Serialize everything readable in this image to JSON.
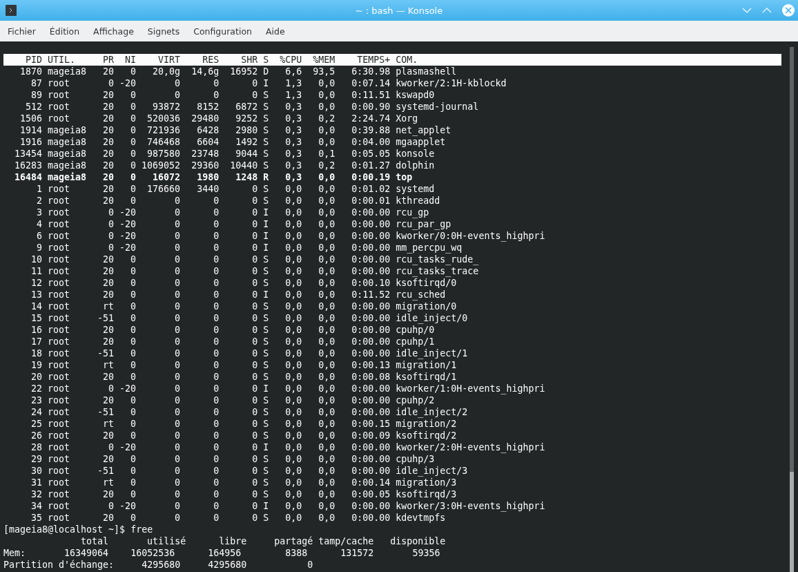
{
  "window": {
    "title": "~ : bash — Konsole"
  },
  "menu": [
    "Fichier",
    "Édition",
    "Affichage",
    "Signets",
    "Configuration",
    "Aide"
  ],
  "top": {
    "columns": [
      "PID",
      "UTIL.",
      "PR",
      "NI",
      "VIRT",
      "RES",
      "SHR",
      "S",
      "%CPU",
      "%MEM",
      "TEMPS+",
      "COM."
    ],
    "rows": [
      {
        "bold": false,
        "cells": [
          "1870",
          "mageia8",
          "20",
          "0",
          "20,0g",
          "14,6g",
          "16952",
          "D",
          "6,6",
          "93,5",
          "6:30.98",
          "plasmashell"
        ]
      },
      {
        "bold": false,
        "cells": [
          "87",
          "root",
          "0",
          "-20",
          "0",
          "0",
          "0",
          "I",
          "1,3",
          "0,0",
          "0:07.14",
          "kworker/2:1H-kblockd"
        ]
      },
      {
        "bold": false,
        "cells": [
          "89",
          "root",
          "20",
          "0",
          "0",
          "0",
          "0",
          "S",
          "1,3",
          "0,0",
          "0:11.51",
          "kswapd0"
        ]
      },
      {
        "bold": false,
        "cells": [
          "512",
          "root",
          "20",
          "0",
          "93872",
          "8152",
          "6872",
          "S",
          "0,3",
          "0,0",
          "0:00.90",
          "systemd-journal"
        ]
      },
      {
        "bold": false,
        "cells": [
          "1506",
          "root",
          "20",
          "0",
          "520036",
          "29480",
          "9252",
          "S",
          "0,3",
          "0,2",
          "2:24.74",
          "Xorg"
        ]
      },
      {
        "bold": false,
        "cells": [
          "1914",
          "mageia8",
          "20",
          "0",
          "721936",
          "6428",
          "2980",
          "S",
          "0,3",
          "0,0",
          "0:39.88",
          "net_applet"
        ]
      },
      {
        "bold": false,
        "cells": [
          "1916",
          "mageia8",
          "20",
          "0",
          "746468",
          "6604",
          "1492",
          "S",
          "0,3",
          "0,0",
          "0:04.00",
          "mgaapplet"
        ]
      },
      {
        "bold": false,
        "cells": [
          "13454",
          "mageia8",
          "20",
          "0",
          "987580",
          "23748",
          "9044",
          "S",
          "0,3",
          "0,1",
          "0:05.05",
          "konsole"
        ]
      },
      {
        "bold": false,
        "cells": [
          "16283",
          "mageia8",
          "20",
          "0",
          "1069052",
          "29360",
          "10440",
          "S",
          "0,3",
          "0,2",
          "0:01.27",
          "dolphin"
        ]
      },
      {
        "bold": true,
        "cells": [
          "16484",
          "mageia8",
          "20",
          "0",
          "16072",
          "1980",
          "1248",
          "R",
          "0,3",
          "0,0",
          "0:00.19",
          "top"
        ]
      },
      {
        "bold": false,
        "cells": [
          "1",
          "root",
          "20",
          "0",
          "176660",
          "3440",
          "0",
          "S",
          "0,0",
          "0,0",
          "0:01.02",
          "systemd"
        ]
      },
      {
        "bold": false,
        "cells": [
          "2",
          "root",
          "20",
          "0",
          "0",
          "0",
          "0",
          "S",
          "0,0",
          "0,0",
          "0:00.01",
          "kthreadd"
        ]
      },
      {
        "bold": false,
        "cells": [
          "3",
          "root",
          "0",
          "-20",
          "0",
          "0",
          "0",
          "I",
          "0,0",
          "0,0",
          "0:00.00",
          "rcu_gp"
        ]
      },
      {
        "bold": false,
        "cells": [
          "4",
          "root",
          "0",
          "-20",
          "0",
          "0",
          "0",
          "I",
          "0,0",
          "0,0",
          "0:00.00",
          "rcu_par_gp"
        ]
      },
      {
        "bold": false,
        "cells": [
          "6",
          "root",
          "0",
          "-20",
          "0",
          "0",
          "0",
          "I",
          "0,0",
          "0,0",
          "0:00.00",
          "kworker/0:0H-events_highpri"
        ]
      },
      {
        "bold": false,
        "cells": [
          "9",
          "root",
          "0",
          "-20",
          "0",
          "0",
          "0",
          "I",
          "0,0",
          "0,0",
          "0:00.00",
          "mm_percpu_wq"
        ]
      },
      {
        "bold": false,
        "cells": [
          "10",
          "root",
          "20",
          "0",
          "0",
          "0",
          "0",
          "S",
          "0,0",
          "0,0",
          "0:00.00",
          "rcu_tasks_rude_"
        ]
      },
      {
        "bold": false,
        "cells": [
          "11",
          "root",
          "20",
          "0",
          "0",
          "0",
          "0",
          "S",
          "0,0",
          "0,0",
          "0:00.00",
          "rcu_tasks_trace"
        ]
      },
      {
        "bold": false,
        "cells": [
          "12",
          "root",
          "20",
          "0",
          "0",
          "0",
          "0",
          "S",
          "0,0",
          "0,0",
          "0:00.10",
          "ksoftirqd/0"
        ]
      },
      {
        "bold": false,
        "cells": [
          "13",
          "root",
          "20",
          "0",
          "0",
          "0",
          "0",
          "I",
          "0,0",
          "0,0",
          "0:11.52",
          "rcu_sched"
        ]
      },
      {
        "bold": false,
        "cells": [
          "14",
          "root",
          "rt",
          "0",
          "0",
          "0",
          "0",
          "S",
          "0,0",
          "0,0",
          "0:00.00",
          "migration/0"
        ]
      },
      {
        "bold": false,
        "cells": [
          "15",
          "root",
          "-51",
          "0",
          "0",
          "0",
          "0",
          "S",
          "0,0",
          "0,0",
          "0:00.00",
          "idle_inject/0"
        ]
      },
      {
        "bold": false,
        "cells": [
          "16",
          "root",
          "20",
          "0",
          "0",
          "0",
          "0",
          "S",
          "0,0",
          "0,0",
          "0:00.00",
          "cpuhp/0"
        ]
      },
      {
        "bold": false,
        "cells": [
          "17",
          "root",
          "20",
          "0",
          "0",
          "0",
          "0",
          "S",
          "0,0",
          "0,0",
          "0:00.00",
          "cpuhp/1"
        ]
      },
      {
        "bold": false,
        "cells": [
          "18",
          "root",
          "-51",
          "0",
          "0",
          "0",
          "0",
          "S",
          "0,0",
          "0,0",
          "0:00.00",
          "idle_inject/1"
        ]
      },
      {
        "bold": false,
        "cells": [
          "19",
          "root",
          "rt",
          "0",
          "0",
          "0",
          "0",
          "S",
          "0,0",
          "0,0",
          "0:00.13",
          "migration/1"
        ]
      },
      {
        "bold": false,
        "cells": [
          "20",
          "root",
          "20",
          "0",
          "0",
          "0",
          "0",
          "S",
          "0,0",
          "0,0",
          "0:00.08",
          "ksoftirqd/1"
        ]
      },
      {
        "bold": false,
        "cells": [
          "22",
          "root",
          "0",
          "-20",
          "0",
          "0",
          "0",
          "I",
          "0,0",
          "0,0",
          "0:00.00",
          "kworker/1:0H-events_highpri"
        ]
      },
      {
        "bold": false,
        "cells": [
          "23",
          "root",
          "20",
          "0",
          "0",
          "0",
          "0",
          "S",
          "0,0",
          "0,0",
          "0:00.00",
          "cpuhp/2"
        ]
      },
      {
        "bold": false,
        "cells": [
          "24",
          "root",
          "-51",
          "0",
          "0",
          "0",
          "0",
          "S",
          "0,0",
          "0,0",
          "0:00.00",
          "idle_inject/2"
        ]
      },
      {
        "bold": false,
        "cells": [
          "25",
          "root",
          "rt",
          "0",
          "0",
          "0",
          "0",
          "S",
          "0,0",
          "0,0",
          "0:00.15",
          "migration/2"
        ]
      },
      {
        "bold": false,
        "cells": [
          "26",
          "root",
          "20",
          "0",
          "0",
          "0",
          "0",
          "S",
          "0,0",
          "0,0",
          "0:00.09",
          "ksoftirqd/2"
        ]
      },
      {
        "bold": false,
        "cells": [
          "28",
          "root",
          "0",
          "-20",
          "0",
          "0",
          "0",
          "I",
          "0,0",
          "0,0",
          "0:00.00",
          "kworker/2:0H-events_highpri"
        ]
      },
      {
        "bold": false,
        "cells": [
          "29",
          "root",
          "20",
          "0",
          "0",
          "0",
          "0",
          "S",
          "0,0",
          "0,0",
          "0:00.00",
          "cpuhp/3"
        ]
      },
      {
        "bold": false,
        "cells": [
          "30",
          "root",
          "-51",
          "0",
          "0",
          "0",
          "0",
          "S",
          "0,0",
          "0,0",
          "0:00.00",
          "idle_inject/3"
        ]
      },
      {
        "bold": false,
        "cells": [
          "31",
          "root",
          "rt",
          "0",
          "0",
          "0",
          "0",
          "S",
          "0,0",
          "0,0",
          "0:00.14",
          "migration/3"
        ]
      },
      {
        "bold": false,
        "cells": [
          "32",
          "root",
          "20",
          "0",
          "0",
          "0",
          "0",
          "S",
          "0,0",
          "0,0",
          "0:00.05",
          "ksoftirqd/3"
        ]
      },
      {
        "bold": false,
        "cells": [
          "34",
          "root",
          "0",
          "-20",
          "0",
          "0",
          "0",
          "I",
          "0,0",
          "0,0",
          "0:00.00",
          "kworker/3:0H-events_highpri"
        ]
      },
      {
        "bold": false,
        "cells": [
          "35",
          "root",
          "20",
          "0",
          "0",
          "0",
          "0",
          "S",
          "0,0",
          "0,0",
          "0:00.00",
          "kdevtmpfs"
        ]
      }
    ]
  },
  "prompt": {
    "prompt": "[mageia8@localhost ~]$",
    "command": "free"
  },
  "free": {
    "columns": [
      "total",
      "utilisé",
      "libre",
      "partagé",
      "tamp/cache",
      "disponible"
    ],
    "rows": [
      {
        "label": "Mem:",
        "values": [
          "16349064",
          "16052536",
          "164956",
          "8388",
          "131572",
          "59356"
        ]
      },
      {
        "label": "Partition d'échange:",
        "values": [
          "4295680",
          "4295680",
          "0"
        ]
      }
    ]
  }
}
